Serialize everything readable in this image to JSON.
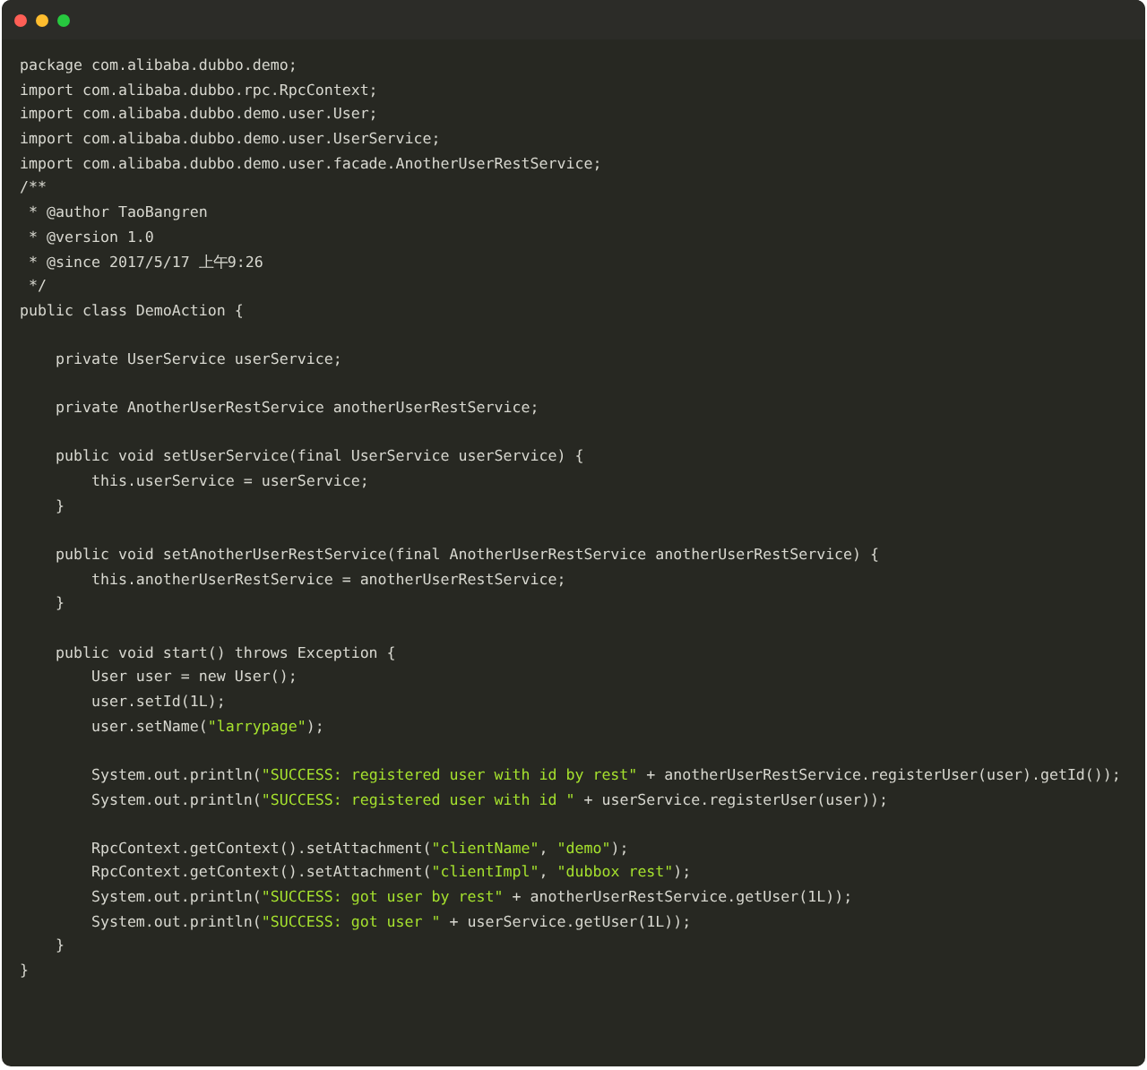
{
  "window": {
    "controls": [
      {
        "color": "#ff5f56"
      },
      {
        "color": "#ffbd2e"
      },
      {
        "color": "#27c93f"
      }
    ]
  },
  "code_blocks": [
    [
      [
        {
          "kind": "code",
          "text": "package com.alibaba.dubbo.demo;"
        }
      ],
      [
        {
          "kind": "code",
          "text": "import com.alibaba.dubbo.rpc.RpcContext;"
        }
      ],
      [
        {
          "kind": "code",
          "text": "import com.alibaba.dubbo.demo.user.User;"
        }
      ],
      [
        {
          "kind": "code",
          "text": "import com.alibaba.dubbo.demo.user.UserService;"
        }
      ],
      [
        {
          "kind": "code",
          "text": "import com.alibaba.dubbo.demo.user.facade.AnotherUserRestService;"
        }
      ],
      [
        {
          "kind": "code",
          "text": "/**"
        }
      ],
      [
        {
          "kind": "code",
          "text": " * @author TaoBangren"
        }
      ],
      [
        {
          "kind": "code",
          "text": " * @version 1.0"
        }
      ],
      [
        {
          "kind": "code",
          "text": " * @since 2017/5/17 上午9:26"
        }
      ],
      [
        {
          "kind": "code",
          "text": " */"
        }
      ],
      [
        {
          "kind": "code",
          "text": "public class DemoAction {"
        }
      ]
    ],
    [
      [
        {
          "kind": "code",
          "text": "    private UserService userService;"
        }
      ]
    ],
    [
      [
        {
          "kind": "code",
          "text": "    private AnotherUserRestService anotherUserRestService;"
        }
      ]
    ],
    [
      [
        {
          "kind": "code",
          "text": "    public void setUserService(final UserService userService) {"
        }
      ],
      [
        {
          "kind": "code",
          "text": "        this.userService = userService;"
        }
      ],
      [
        {
          "kind": "code",
          "text": "    }"
        }
      ]
    ],
    [
      [
        {
          "kind": "code",
          "text": "    public void setAnotherUserRestService(final AnotherUserRestService anotherUserRestService) {"
        }
      ],
      [
        {
          "kind": "code",
          "text": "        this.anotherUserRestService = anotherUserRestService;"
        }
      ],
      [
        {
          "kind": "code",
          "text": "    }"
        }
      ]
    ],
    [
      [
        {
          "kind": "code",
          "text": "    public void start() throws Exception {"
        }
      ],
      [
        {
          "kind": "code",
          "text": "        User user = new User();"
        }
      ],
      [
        {
          "kind": "code",
          "text": "        user.setId(1L);"
        }
      ],
      [
        {
          "kind": "code",
          "text": "        user.setName("
        },
        {
          "kind": "string",
          "text": "\"larrypage\""
        },
        {
          "kind": "code",
          "text": ");"
        }
      ]
    ],
    [
      [
        {
          "kind": "code",
          "text": "        System.out.println("
        },
        {
          "kind": "string",
          "text": "\"SUCCESS: registered user with id by rest\""
        },
        {
          "kind": "code",
          "text": " + anotherUserRestService.registerUser(user).getId());"
        }
      ],
      [
        {
          "kind": "code",
          "text": "        System.out.println("
        },
        {
          "kind": "string",
          "text": "\"SUCCESS: registered user with id \""
        },
        {
          "kind": "code",
          "text": " + userService.registerUser(user));"
        }
      ]
    ],
    [
      [
        {
          "kind": "code",
          "text": "        RpcContext.getContext().setAttachment("
        },
        {
          "kind": "string",
          "text": "\"clientName\""
        },
        {
          "kind": "code",
          "text": ", "
        },
        {
          "kind": "string",
          "text": "\"demo\""
        },
        {
          "kind": "code",
          "text": ");"
        }
      ],
      [
        {
          "kind": "code",
          "text": "        RpcContext.getContext().setAttachment("
        },
        {
          "kind": "string",
          "text": "\"clientImpl\""
        },
        {
          "kind": "code",
          "text": ", "
        },
        {
          "kind": "string",
          "text": "\"dubbox rest\""
        },
        {
          "kind": "code",
          "text": ");"
        }
      ],
      [
        {
          "kind": "code",
          "text": "        System.out.println("
        },
        {
          "kind": "string",
          "text": "\"SUCCESS: got user by rest\""
        },
        {
          "kind": "code",
          "text": " + anotherUserRestService.getUser(1L));"
        }
      ],
      [
        {
          "kind": "code",
          "text": "        System.out.println("
        },
        {
          "kind": "string",
          "text": "\"SUCCESS: got user \""
        },
        {
          "kind": "code",
          "text": " + userService.getUser(1L));"
        }
      ],
      [
        {
          "kind": "code",
          "text": "    }"
        }
      ],
      [
        {
          "kind": "code",
          "text": "}"
        }
      ]
    ]
  ]
}
